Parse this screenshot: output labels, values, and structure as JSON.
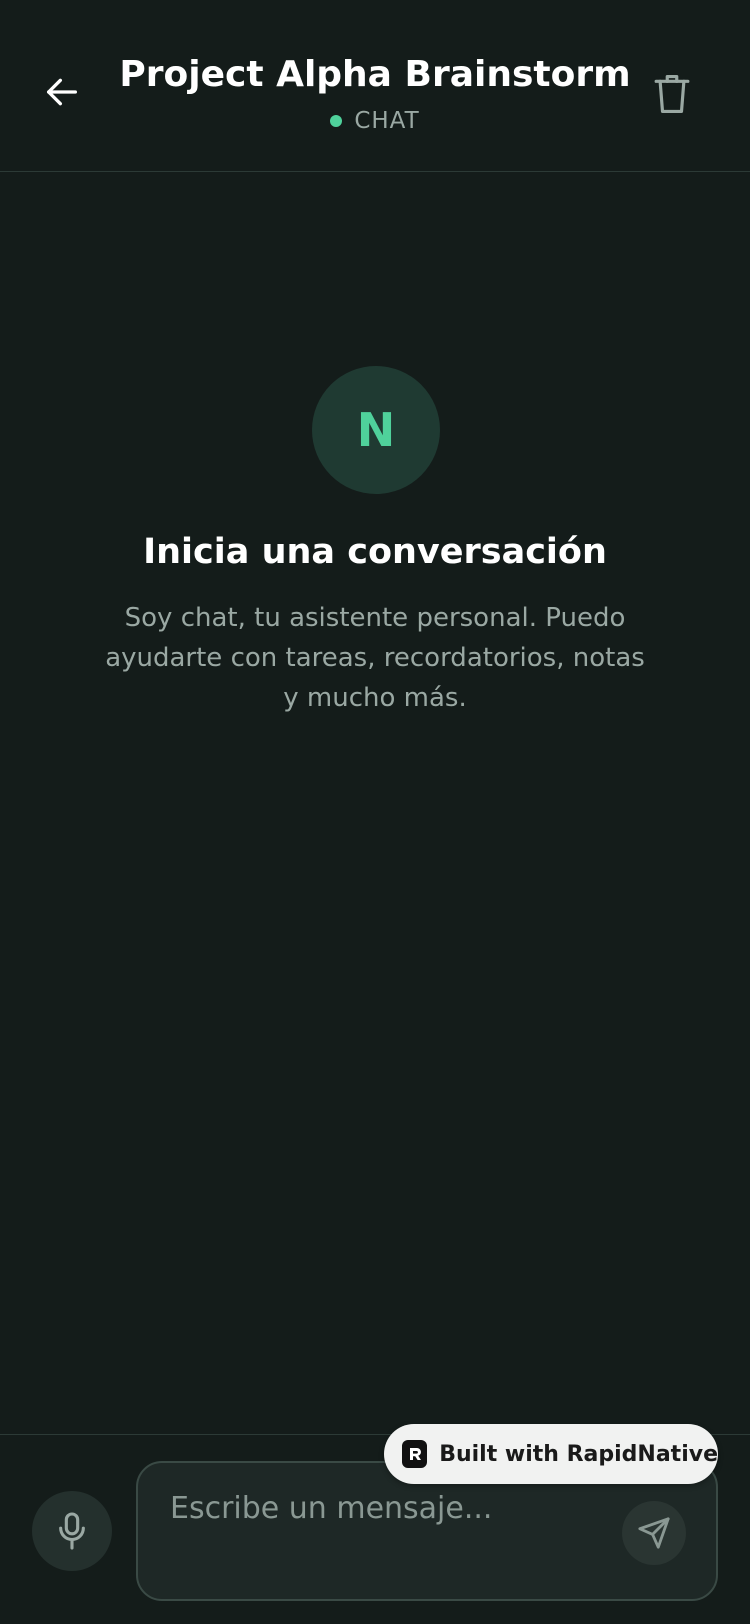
{
  "header": {
    "title": "Project Alpha Brainstorm",
    "subtitle": "CHAT",
    "back_icon": "arrow-left-icon",
    "delete_icon": "trash-icon"
  },
  "empty_state": {
    "avatar_letter": "N",
    "title": "Inicia una conversación",
    "description": "Soy chat, tu asistente personal. Puedo ayudarte con tareas, recordatorios, notas y mucho más."
  },
  "composer": {
    "placeholder": "Escribe un mensaje...",
    "mic_icon": "microphone-icon",
    "send_icon": "send-icon"
  },
  "badge": {
    "label": "Built with RapidNative"
  },
  "colors": {
    "background": "#141c1a",
    "accent": "#4fd19b",
    "muted_text": "#9aa8a3"
  }
}
